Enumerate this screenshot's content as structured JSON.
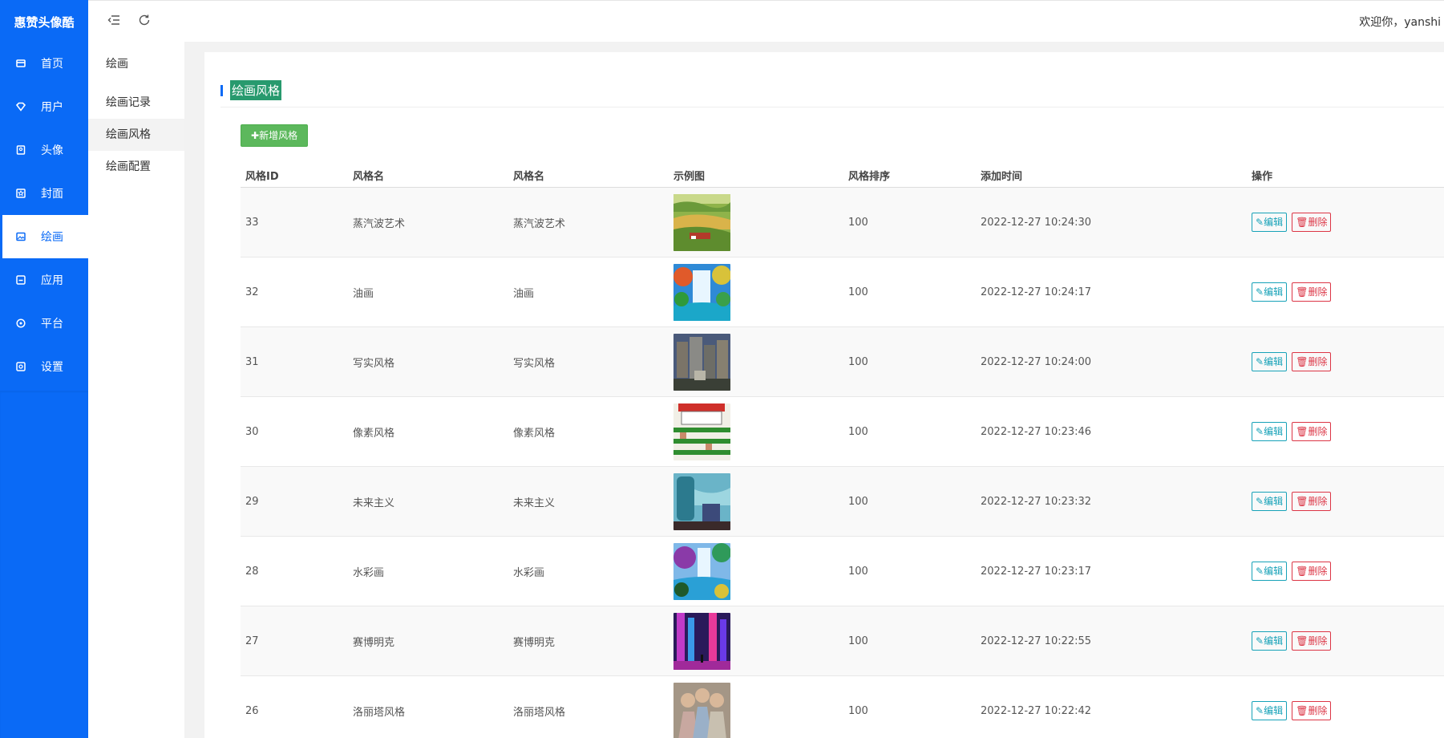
{
  "app": {
    "brand": "惠赞头像酷"
  },
  "nav": [
    {
      "label": "首页",
      "icon": "home-icon",
      "active": false
    },
    {
      "label": "用户",
      "icon": "diamond-icon",
      "active": false
    },
    {
      "label": "头像",
      "icon": "avatar-icon",
      "active": false
    },
    {
      "label": "封面",
      "icon": "cover-icon",
      "active": false
    },
    {
      "label": "绘画",
      "icon": "image-icon",
      "active": true
    },
    {
      "label": "应用",
      "icon": "app-icon",
      "active": false
    },
    {
      "label": "平台",
      "icon": "platform-icon",
      "active": false
    },
    {
      "label": "设置",
      "icon": "settings-icon",
      "active": false
    }
  ],
  "header": {
    "welcome": "欢迎你，yanshi"
  },
  "submenu": {
    "title": "绘画",
    "items": [
      {
        "label": "绘画记录",
        "active": false
      },
      {
        "label": "绘画风格",
        "active": true
      },
      {
        "label": "绘画配置",
        "active": false
      }
    ]
  },
  "page": {
    "title": "绘画风格",
    "add_button": "新增风格"
  },
  "table": {
    "headers": [
      "风格ID",
      "风格名",
      "风格名",
      "示例图",
      "风格排序",
      "添加时间",
      "操作"
    ],
    "edit_label": "编辑",
    "delete_label": "删除",
    "rows": [
      {
        "id": "33",
        "name": "蒸汽波艺术",
        "name2": "蒸汽波艺术",
        "thumb": "landscape-thumbnail",
        "sort": "100",
        "time": "2022-12-27 10:24:30"
      },
      {
        "id": "32",
        "name": "油画",
        "name2": "油画",
        "thumb": "waterfall-thumbnail",
        "sort": "100",
        "time": "2022-12-27 10:24:17"
      },
      {
        "id": "31",
        "name": "写实风格",
        "name2": "写实风格",
        "thumb": "city-thumbnail",
        "sort": "100",
        "time": "2022-12-27 10:24:00"
      },
      {
        "id": "30",
        "name": "像素风格",
        "name2": "像素风格",
        "thumb": "pixel-thumbnail",
        "sort": "100",
        "time": "2022-12-27 10:23:46"
      },
      {
        "id": "29",
        "name": "未来主义",
        "name2": "未来主义",
        "thumb": "future-thumbnail",
        "sort": "100",
        "time": "2022-12-27 10:23:32"
      },
      {
        "id": "28",
        "name": "水彩画",
        "name2": "水彩画",
        "thumb": "watercolor-thumbnail",
        "sort": "100",
        "time": "2022-12-27 10:23:17"
      },
      {
        "id": "27",
        "name": "赛博明克",
        "name2": "赛博明克",
        "thumb": "cyberpunk-thumbnail",
        "sort": "100",
        "time": "2022-12-27 10:22:55"
      },
      {
        "id": "26",
        "name": "洛丽塔风格",
        "name2": "洛丽塔风格",
        "thumb": "lolita-thumbnail",
        "sort": "100",
        "time": "2022-12-27 10:22:42"
      }
    ]
  },
  "colors": {
    "primary": "#0a6af6",
    "success": "#5cb85c",
    "title_highlight": "#289a6e",
    "info": "#17a2b8",
    "danger": "#dc3545"
  }
}
